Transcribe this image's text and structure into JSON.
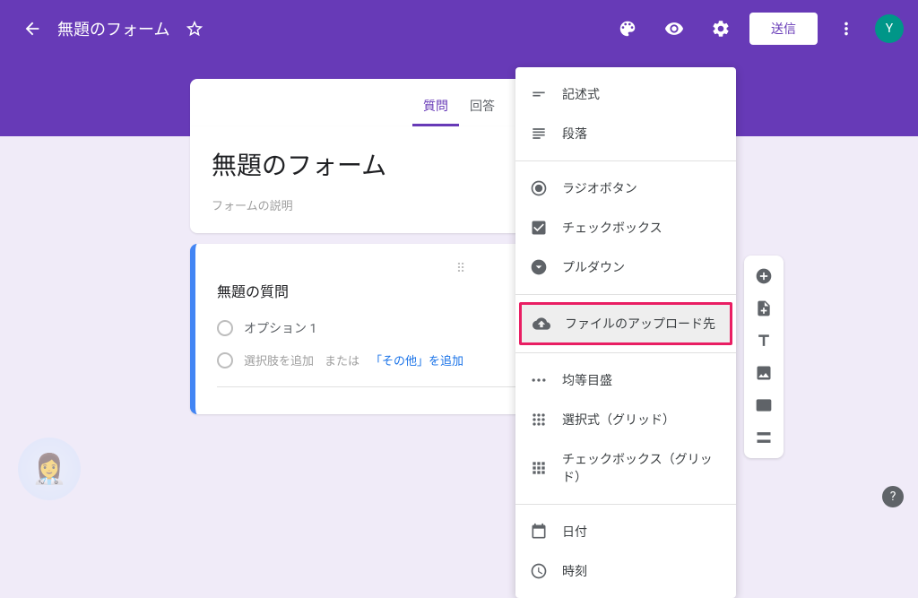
{
  "header": {
    "title": "無題のフォーム",
    "send_label": "送信",
    "avatar_initial": "Y"
  },
  "tabs": {
    "questions": "質問",
    "responses": "回答"
  },
  "form": {
    "title": "無題のフォーム",
    "description": "フォームの説明"
  },
  "question": {
    "title": "無題の質問",
    "option1": "オプション 1",
    "add_option": "選択肢を追加",
    "or_text": " または ",
    "add_other": "「その他」を追加"
  },
  "menu": {
    "short_answer": "記述式",
    "paragraph": "段落",
    "radio": "ラジオボタン",
    "checkbox": "チェックボックス",
    "dropdown": "プルダウン",
    "file_upload": "ファイルのアップロード先",
    "linear_scale": "均等目盛",
    "grid_choice": "選択式（グリッド）",
    "grid_checkbox": "チェックボックス（グリッド）",
    "date": "日付",
    "time": "時刻"
  }
}
